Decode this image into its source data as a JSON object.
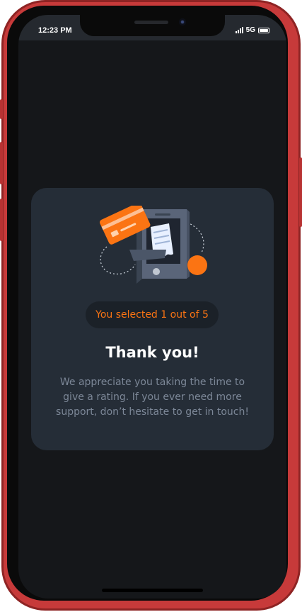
{
  "status_bar": {
    "time": "12:23 PM",
    "network": "5G",
    "signal_icon": "signal-icon",
    "battery_icon": "battery-icon"
  },
  "card": {
    "illustration": "phone-payment-receipt-illustration",
    "selected_text": "You selected 1 out of 5",
    "rating": 1,
    "rating_max": 5,
    "title": "Thank you!",
    "description": "We appreciate you taking the time to give a rating. If you ever need more support, don’t hesitate to get in touch!"
  },
  "colors": {
    "accent": "#fb7413",
    "card_bg": "#252d37",
    "page_bg": "#15171a",
    "muted_text": "#7c8797"
  }
}
